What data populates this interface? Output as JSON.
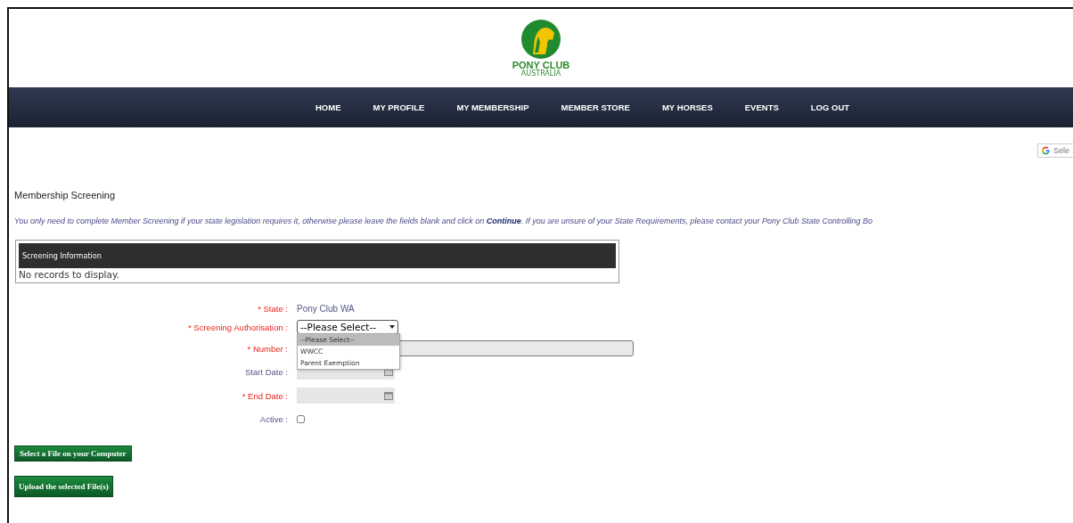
{
  "logo": {
    "name": "PONY CLUB",
    "subtitle": "AUSTRALIA"
  },
  "nav": [
    {
      "label": "HOME"
    },
    {
      "label": "MY PROFILE"
    },
    {
      "label": "MY MEMBERSHIP"
    },
    {
      "label": "MEMBER STORE"
    },
    {
      "label": "MY HORSES"
    },
    {
      "label": "EVENTS"
    },
    {
      "label": "LOG OUT"
    }
  ],
  "translate_button": {
    "label": "Sele"
  },
  "page_title": "Membership Screening",
  "instructions": {
    "before": "You only need to complete Member Screening if your state legislation requires it, otherwise please leave the fields blank and click on ",
    "link": "Continue",
    "after": ". If you are unsure of your State Requirements, please contact your Pony Club State Controlling Bo"
  },
  "grid": {
    "header": "Screening Information",
    "empty_text": "No records to display."
  },
  "form": [
    {
      "kind": "text",
      "label": "* State :",
      "required": true,
      "value": "Pony Club WA"
    },
    {
      "kind": "select",
      "label": "* Screening Authorisation :",
      "required": true,
      "value": "--Please Select--",
      "expanded": true,
      "options": [
        {
          "label": "--Please Select--",
          "selected": true
        },
        {
          "label": "WWCC",
          "selected": false
        },
        {
          "label": "Parent Exemption",
          "selected": false
        }
      ]
    },
    {
      "kind": "input",
      "label": "* Number :",
      "required": true
    },
    {
      "kind": "date",
      "label": "Start Date :",
      "required": false
    },
    {
      "kind": "date",
      "label": "* End Date :",
      "required": true
    },
    {
      "kind": "checkbox",
      "label": "Active :",
      "required": false,
      "checked": false
    }
  ],
  "buttons": [
    {
      "label": "Select a File on your Computer"
    },
    {
      "label": "Upload the selected File(s)"
    }
  ]
}
